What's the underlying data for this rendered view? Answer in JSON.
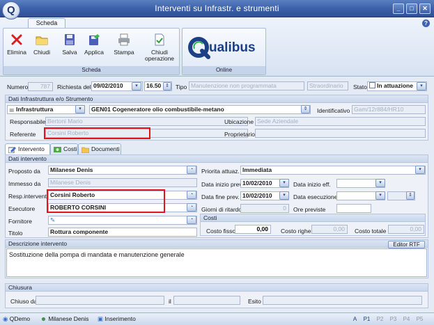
{
  "window": {
    "title": "Interventi su Infrastr. e strumenti",
    "logo_letter": "Q",
    "controls": [
      "_",
      "□",
      "✕"
    ]
  },
  "ribbon": {
    "tab": "Scheda",
    "help": "?",
    "groups": [
      {
        "label": "Scheda",
        "buttons": [
          "Elimina",
          "Chiudi",
          "Salva",
          "Applica",
          "Stampa",
          "Chiudi",
          "operazione"
        ]
      },
      {
        "label": "Online",
        "brand": "ualibus",
        "brand_letter": "Q"
      }
    ]
  },
  "header": {
    "numero_label": "Numero",
    "numero_value": "787",
    "richiesta_label": "Richiesta del",
    "richiesta_date": "09/02/2010",
    "richiesta_time": "16.50",
    "tipo_label": "Tipo",
    "tipo_value": "Manutenzione non programmata",
    "straordinario": "Straordinario",
    "stato_label": "Stato",
    "stato_value": "In attuazione"
  },
  "infrastructure": {
    "title": "Dati Infrastruttura e/o Strumento",
    "kind": "Infrastruttura",
    "name": "GEN01 Cogeneratore olio combustibile-metano",
    "identificativo_label": "Identificativo",
    "identificativo_value": "Gam/12r884/HR10",
    "responsabile_label": "Responsabile",
    "responsabile_value": "Bertoni Mario",
    "ubicazione_label": "Ubicazione",
    "ubicazione_value": "Sede Aziendale",
    "referente_label": "Referente",
    "referente_value": "Corsini Roberto",
    "proprietario_label": "Proprietario",
    "proprietario_value": ""
  },
  "tabs": [
    "Intervento",
    "Costi",
    "Documenti"
  ],
  "intervento": {
    "title": "Dati intervento",
    "proposto_label": "Proposto da",
    "proposto_value": "Milanese Denis",
    "immesso_label": "Immesso da",
    "immesso_value": "Milanese Denis",
    "resp_label": "Resp.intervento",
    "resp_value": "Corsini Roberto",
    "esecutore_label": "Esecutore",
    "esecutore_value": "ROBERTO CORSINI",
    "fornitore_label": "Fornitore",
    "titolo_label": "Titolo",
    "titolo_value": "Rottura componente",
    "priorita_label": "Priorita attuaz.",
    "priorita_value": "Immediata",
    "inizio_prev_label": "Data inizio prev.",
    "inizio_prev_value": "10/02/2010",
    "inizio_eff_label": "Data inizio eff.",
    "fine_prev_label": "Data fine prev.",
    "fine_prev_value": "10/02/2010",
    "esecuzione_label": "Data esecuzione",
    "ritardo_label": "Giorni di ritardo",
    "ritardo_value": "0",
    "ore_label": "Ore previste",
    "costi_title": "Costi",
    "costo_fisso_label": "Costo fisso",
    "costo_fisso_value": "0,00",
    "costo_righe_label": "Costo righe",
    "costo_righe_value": "0,00",
    "costo_totale_label": "Costo totale",
    "costo_totale_value": "0,00",
    "descrizione_title": "Descrizione intervento",
    "editor_button": "Editor RTF",
    "descrizione_text": "Sostituzione della pompa di mandata e manutenzione generale"
  },
  "chiusura": {
    "title": "Chiusura",
    "chiuso_label": "Chiuso da",
    "il_label": "il",
    "esito_label": "Esito"
  },
  "statusbar": {
    "db": "QDemo",
    "user": "Milanese Denis",
    "mode": "Inserimento",
    "indicators": [
      "A",
      "P1",
      "P2",
      "P3",
      "P4",
      "P5"
    ]
  },
  "colors": {
    "titlebar": "#3b5fa8",
    "highlight": "#e0141b",
    "accent": "#1f3a78"
  }
}
